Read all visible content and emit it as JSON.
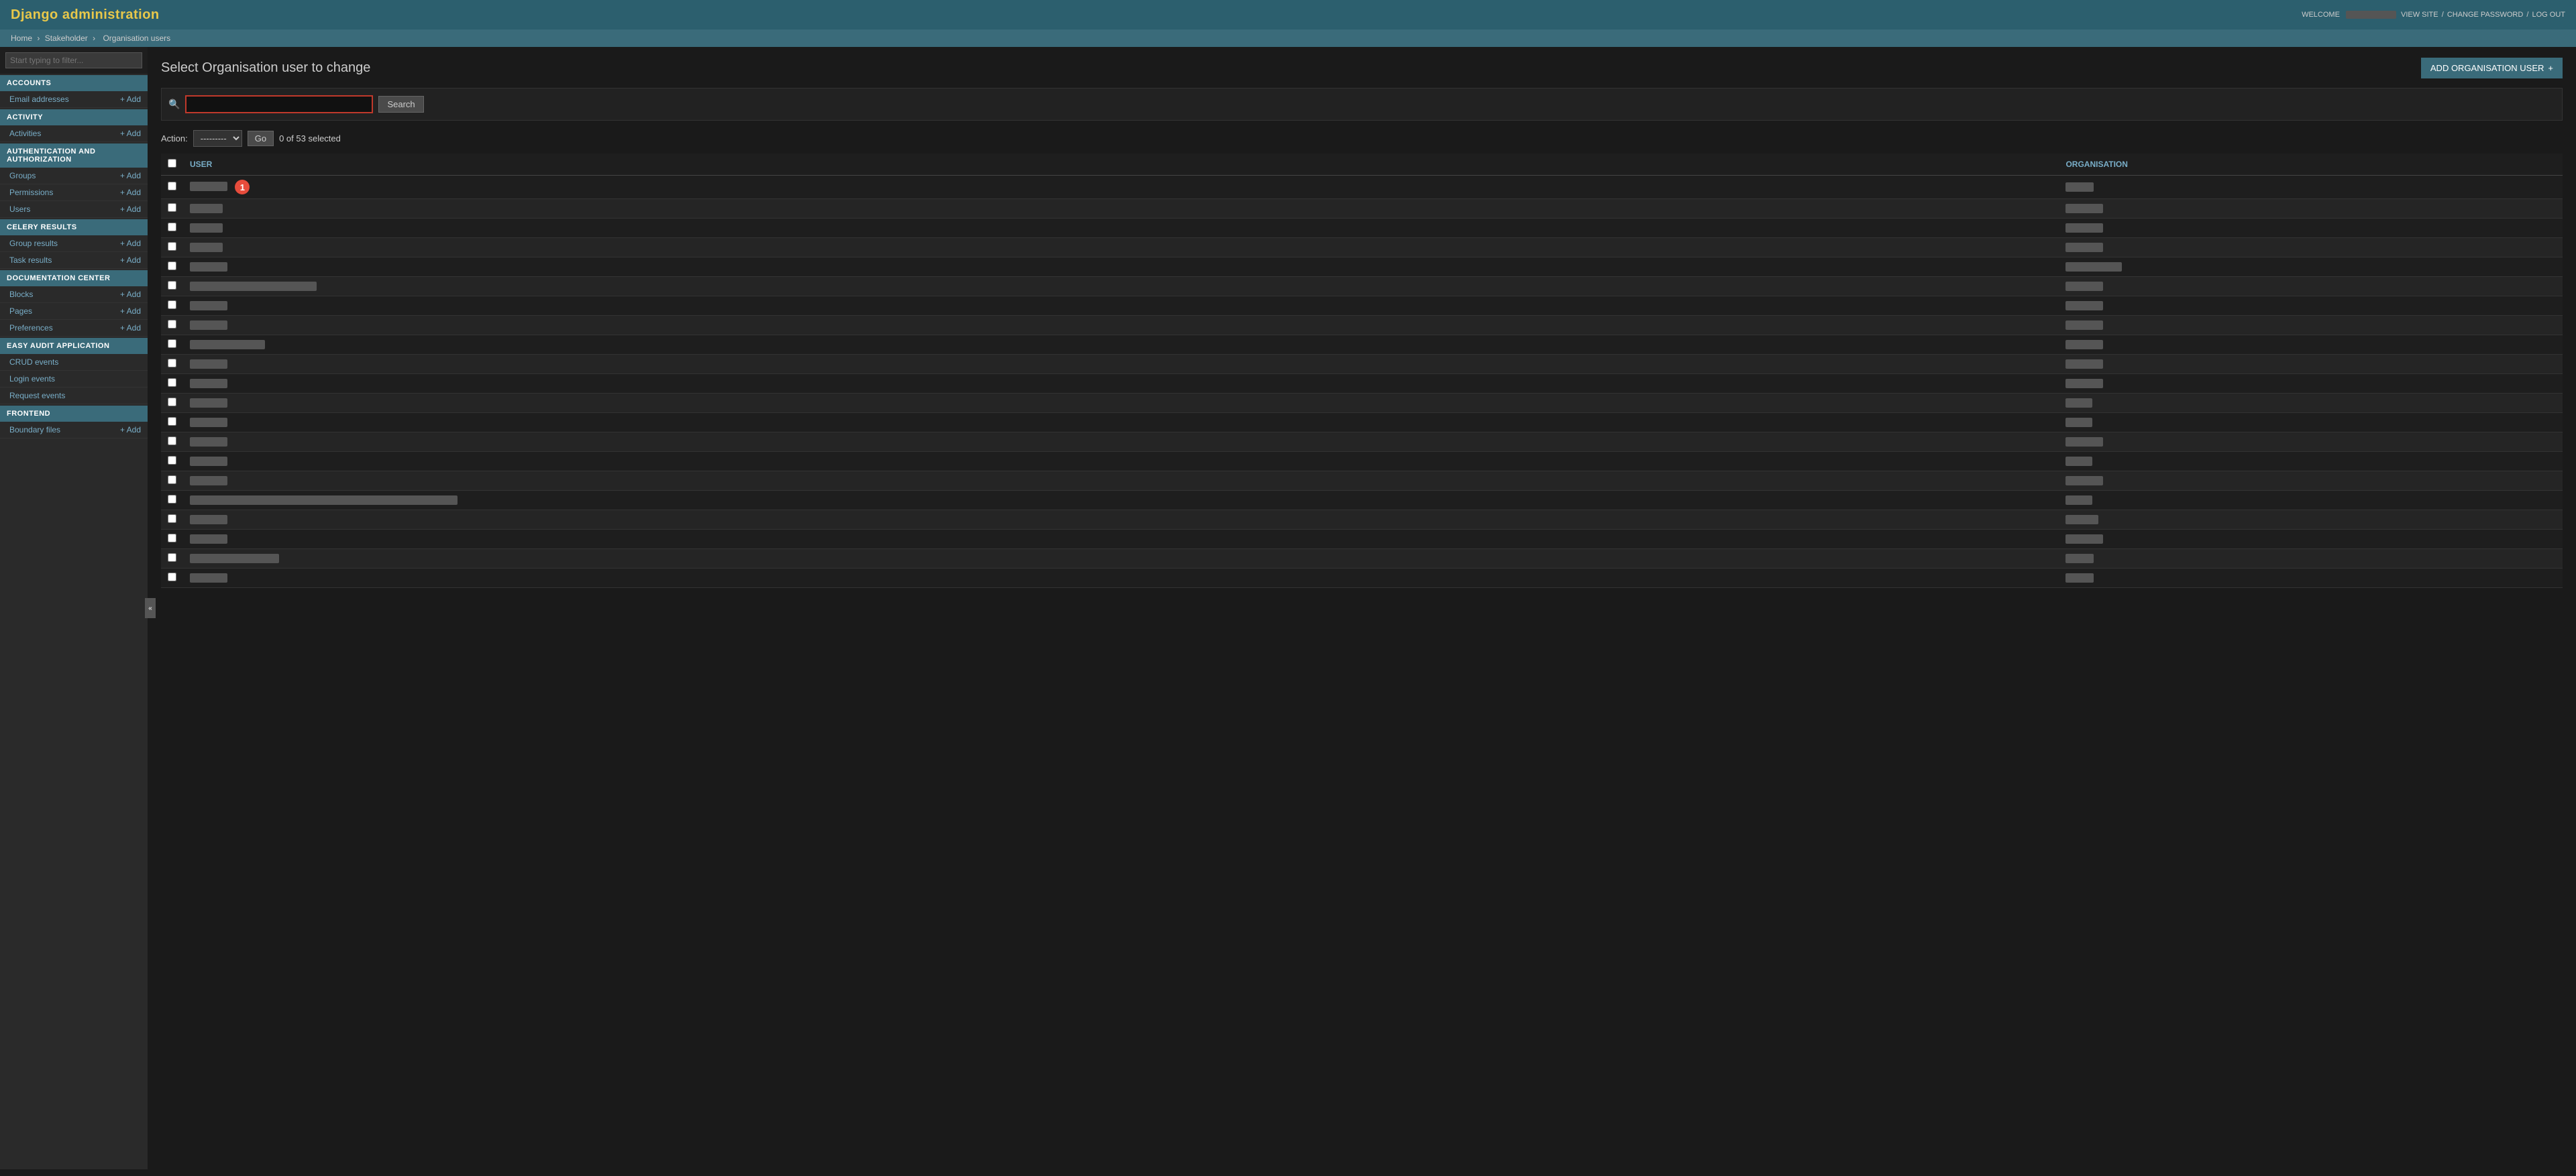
{
  "header": {
    "title": "Django administration",
    "welcome": "WELCOME",
    "username": "█████",
    "links": {
      "view_site": "VIEW SITE",
      "change_password": "CHANGE PASSWORD",
      "log_out": "LOG OUT"
    }
  },
  "breadcrumb": {
    "home": "Home",
    "stakeholder": "Stakeholder",
    "current": "Organisation users"
  },
  "sidebar": {
    "filter_placeholder": "Start typing to filter...",
    "sections": [
      {
        "id": "accounts",
        "label": "ACCOUNTS",
        "items": [
          {
            "label": "Email addresses",
            "add": true
          }
        ]
      },
      {
        "id": "activity",
        "label": "ACTIVITY",
        "items": [
          {
            "label": "Activities",
            "add": true
          }
        ]
      },
      {
        "id": "authentication",
        "label": "AUTHENTICATION AND AUTHORIZATION",
        "items": [
          {
            "label": "Groups",
            "add": true
          },
          {
            "label": "Permissions",
            "add": true
          },
          {
            "label": "Users",
            "add": true
          }
        ]
      },
      {
        "id": "celery",
        "label": "CELERY RESULTS",
        "items": [
          {
            "label": "Group results",
            "add": true
          },
          {
            "label": "Task results",
            "add": true
          }
        ]
      },
      {
        "id": "docCenter",
        "label": "DOCUMENTATION CENTER",
        "items": [
          {
            "label": "Blocks",
            "add": true
          },
          {
            "label": "Pages",
            "add": true
          },
          {
            "label": "Preferences",
            "add": true
          }
        ]
      },
      {
        "id": "easyAudit",
        "label": "EASY AUDIT APPLICATION",
        "items": [
          {
            "label": "CRUD events",
            "add": false
          },
          {
            "label": "Login events",
            "add": false
          },
          {
            "label": "Request events",
            "add": false
          }
        ]
      },
      {
        "id": "frontend",
        "label": "FRONTEND",
        "items": [
          {
            "label": "Boundary files",
            "add": true
          }
        ]
      }
    ]
  },
  "content": {
    "title": "Select Organisation user to change",
    "add_button": "ADD ORGANISATION USER",
    "search_placeholder": "",
    "search_button": "Search",
    "action_label": "Action:",
    "action_default": "---------",
    "go_button": "Go",
    "selected_text": "0 of 53 selected",
    "columns": {
      "user": "USER",
      "organisation": "ORGANISATION"
    },
    "rows": [
      {
        "user": "████████",
        "org": "██████",
        "highlighted": true
      },
      {
        "user": "███████",
        "org": "████████",
        "highlighted": false
      },
      {
        "user": "███████",
        "org": "████████",
        "highlighted": false
      },
      {
        "user": "███████",
        "org": "████████",
        "highlighted": false
      },
      {
        "user": "████████",
        "org": "████████████",
        "highlighted": false
      },
      {
        "user": "███████████████████████████",
        "org": "████████",
        "highlighted": false
      },
      {
        "user": "████████",
        "org": "████████",
        "highlighted": false
      },
      {
        "user": "████████",
        "org": "████████",
        "highlighted": false
      },
      {
        "user": "████████████████",
        "org": "████████",
        "highlighted": false
      },
      {
        "user": "████████",
        "org": "████████",
        "highlighted": false
      },
      {
        "user": "████████",
        "org": "████████",
        "highlighted": false
      },
      {
        "user": "████████",
        "org": "████",
        "highlighted": false
      },
      {
        "user": "████████",
        "org": "████",
        "highlighted": false
      },
      {
        "user": "████████",
        "org": "████████",
        "highlighted": false
      },
      {
        "user": "████████",
        "org": "███",
        "highlighted": false
      },
      {
        "user": "████████",
        "org": "████████",
        "highlighted": false
      },
      {
        "user": "█████████████████████████████████████████████████████████",
        "org": "█████",
        "highlighted": false
      },
      {
        "user": "████████",
        "org": "███████",
        "highlighted": false
      },
      {
        "user": "████████",
        "org": "████████",
        "highlighted": false
      },
      {
        "user": "███████████████████",
        "org": "██████",
        "highlighted": false
      },
      {
        "user": "████████",
        "org": "██████",
        "highlighted": false
      }
    ],
    "badge_number": "1"
  }
}
